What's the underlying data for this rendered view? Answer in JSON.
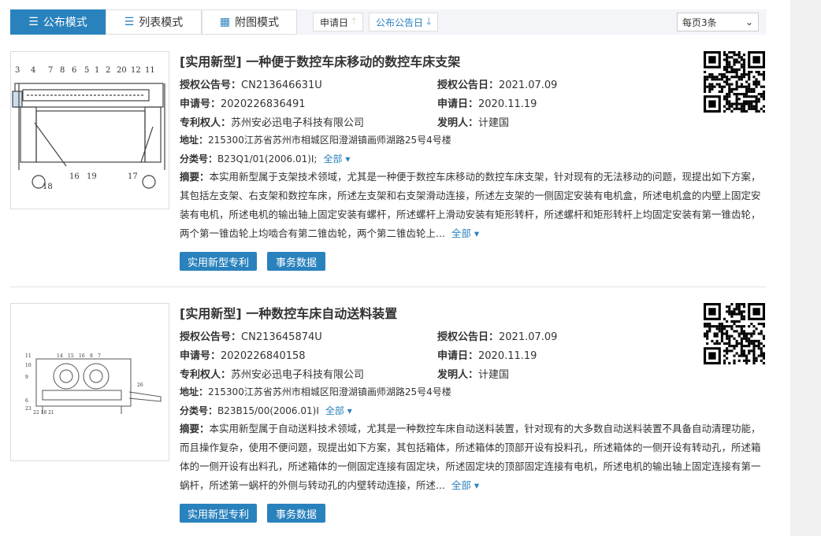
{
  "toolbar": {
    "modes": [
      "公布模式",
      "列表模式",
      "附图模式"
    ],
    "sort": [
      "申请日",
      "公布公告日"
    ],
    "per_page": "每页3条"
  },
  "labels": {
    "pub_no": "授权公告号：",
    "pub_date": "授权公告日：",
    "app_no": "申请号：",
    "app_date": "申请日：",
    "owner": "专利权人：",
    "inventor": "发明人：",
    "address": "地址：",
    "class": "分类号：",
    "abstract": "摘要：",
    "more": "全部",
    "btn_type": "实用新型专利",
    "btn_affairs": "事务数据"
  },
  "patents": [
    {
      "title": "[实用新型] 一种便于数控车床移动的数控车床支架",
      "pub_no": "CN213646631U",
      "pub_date": "2021.07.09",
      "app_no": "2020226836491",
      "app_date": "2020.11.19",
      "owner": "苏州安必迅电子科技有限公司",
      "inventor": "计建国",
      "address": "215300江苏省苏州市相城区阳澄湖镇画师湖路25号4号楼",
      "class": "B23Q1/01(2006.01)I;",
      "abstract": "本实用新型属于支架技术领域，尤其是一种便于数控车床移动的数控车床支架，针对现有的无法移动的问题，现提出如下方案，其包括左支架、右支架和数控车床，所述左支架和右支架滑动连接，所述左支架的一侧固定安装有电机盒，所述电机盒的内壁上固定安装有电机，所述电机的输出轴上固定安装有螺杆，所述螺杆上滑动安装有矩形转杆，所述螺杆和矩形转杆上均固定安装有第一锥齿轮，两个第一锥齿轮上均啮合有第二锥齿轮，两个第二锥齿轮上..."
    },
    {
      "title": "[实用新型] 一种数控车床自动送料装置",
      "pub_no": "CN213645874U",
      "pub_date": "2021.07.09",
      "app_no": "2020226840158",
      "app_date": "2020.11.19",
      "owner": "苏州安必迅电子科技有限公司",
      "inventor": "计建国",
      "address": "215300江苏省苏州市相城区阳澄湖镇画师湖路25号4号楼",
      "class": "B23B15/00(2006.01)I",
      "abstract": "本实用新型属于自动送料技术领域，尤其是一种数控车床自动送料装置，针对现有的大多数自动送料装置不具备自动清理功能，而且操作复杂，使用不便问题，现提出如下方案，其包括箱体，所述箱体的顶部开设有投料孔，所述箱体的一侧开设有转动孔，所述箱体的一侧开设有出料孔，所述箱体的一侧固定连接有固定块，所述固定块的顶部固定连接有电机，所述电机的输出轴上固定连接有第一蜗杆，所述第一蜗杆的外侧与转动孔的内壁转动连接，所述..."
    }
  ]
}
